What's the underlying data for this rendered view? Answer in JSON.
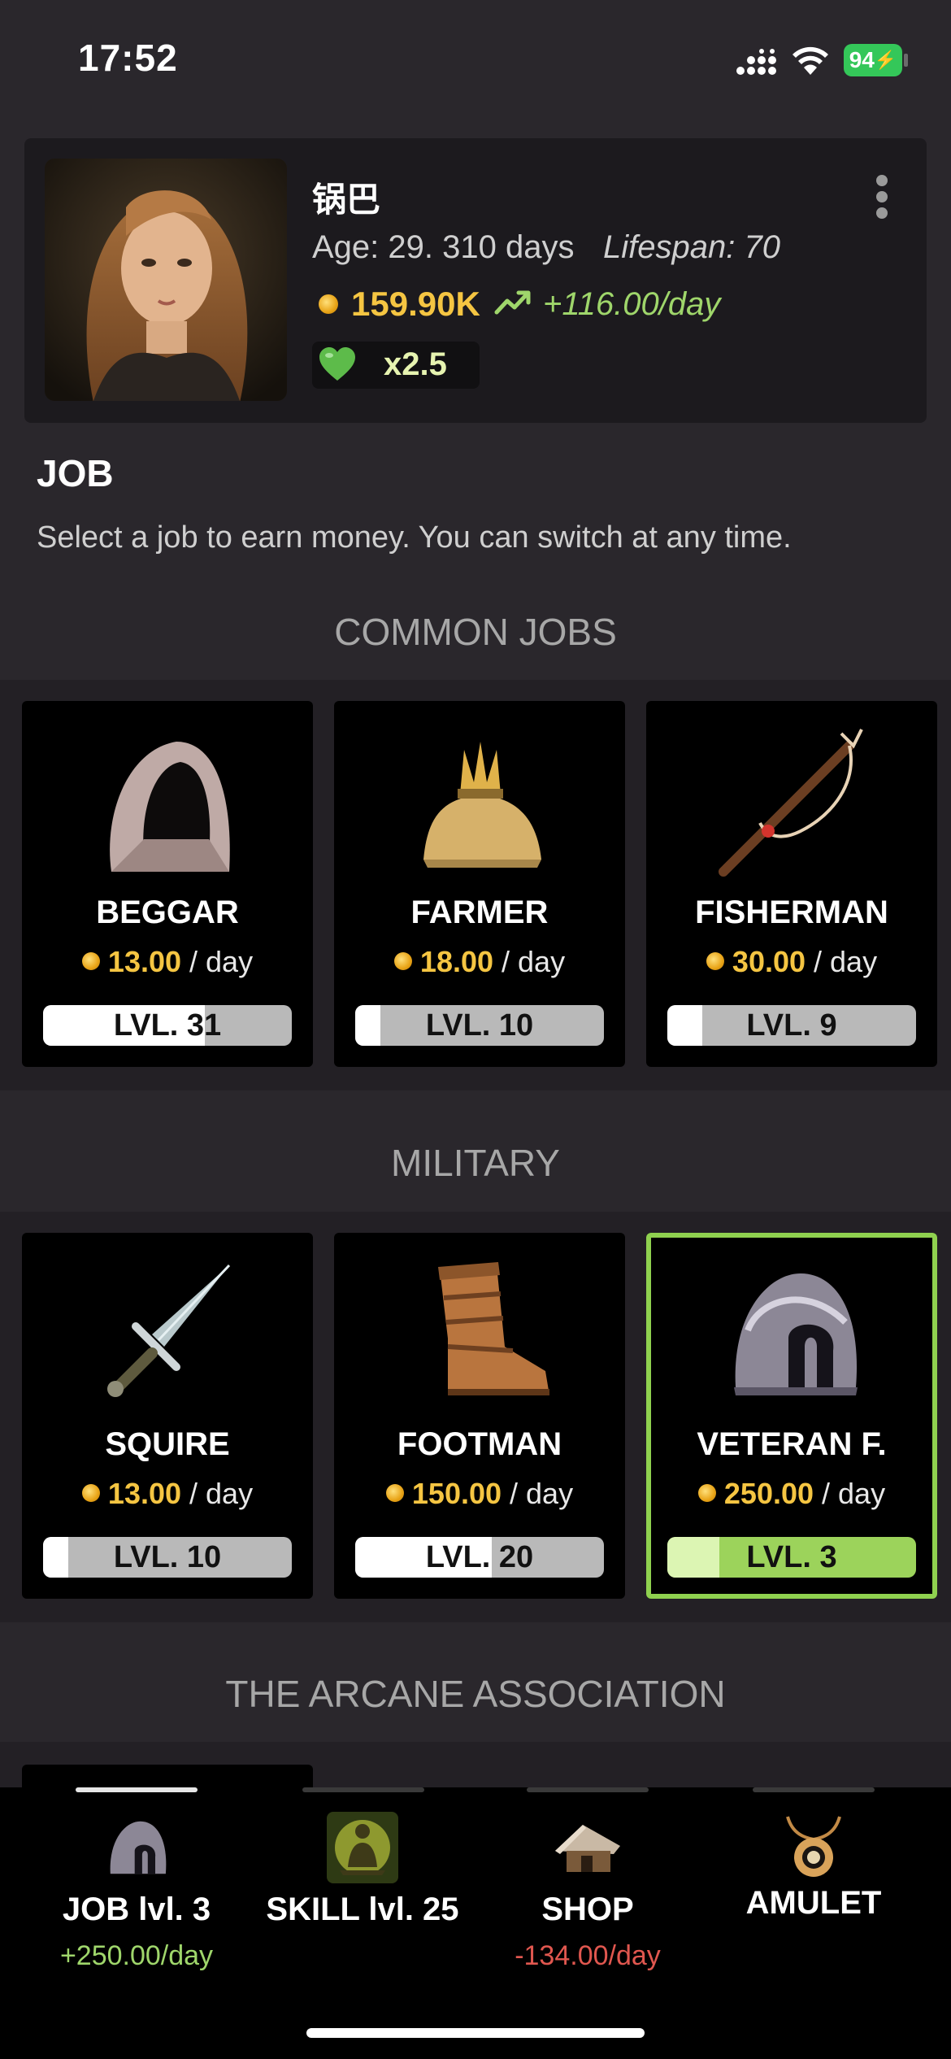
{
  "status_bar": {
    "time": "17:52",
    "battery": "94"
  },
  "profile": {
    "name": "锅巴",
    "age": "Age: 29. 310 days",
    "lifespan": "Lifespan: 70",
    "money": "159.90K",
    "income": "+116.00/day",
    "multiplier": "x2.5"
  },
  "page": {
    "title": "JOB",
    "description": "Select a job to earn money. You can switch at any time."
  },
  "categories": [
    {
      "title": "COMMON JOBS",
      "jobs": [
        {
          "name": "BEGGAR",
          "pay": "13.00",
          "per": "/ day",
          "level": "LVL. 31",
          "progress": 0.65,
          "icon": "hood-icon"
        },
        {
          "name": "FARMER",
          "pay": "18.00",
          "per": "/ day",
          "level": "LVL. 10",
          "progress": 0.1,
          "icon": "grain-sack-icon"
        },
        {
          "name": "FISHERMAN",
          "pay": "30.00",
          "per": "/ day",
          "level": "LVL. 9",
          "progress": 0.14,
          "icon": "fishing-rod-icon"
        }
      ]
    },
    {
      "title": "MILITARY",
      "jobs": [
        {
          "name": "SQUIRE",
          "pay": "13.00",
          "per": "/ day",
          "level": "LVL. 10",
          "progress": 0.1,
          "icon": "dagger-icon"
        },
        {
          "name": "FOOTMAN",
          "pay": "150.00",
          "per": "/ day",
          "level": "LVL. 20",
          "progress": 0.55,
          "icon": "boot-icon"
        },
        {
          "name": "VETERAN F.",
          "pay": "250.00",
          "per": "/ day",
          "level": "LVL. 3",
          "progress": 0.21,
          "icon": "helmet-icon",
          "selected": true
        }
      ]
    },
    {
      "title": "THE ARCANE ASSOCIATION",
      "jobs": []
    }
  ],
  "nav": [
    {
      "label": "JOB lvl. 3",
      "sub": "+250.00/day",
      "icon": "helmet-icon",
      "active": true
    },
    {
      "label": "SKILL lvl. 25",
      "sub": "",
      "icon": "meditation-icon"
    },
    {
      "label": "SHOP",
      "sub": "-134.00/day",
      "icon": "hut-icon"
    },
    {
      "label": "AMULET",
      "sub": "",
      "icon": "amulet-icon"
    }
  ],
  "colors": {
    "accent_green": "#8fd14f",
    "gold": "#f5c542",
    "positive": "#9fd66b",
    "negative": "#e0574f"
  }
}
